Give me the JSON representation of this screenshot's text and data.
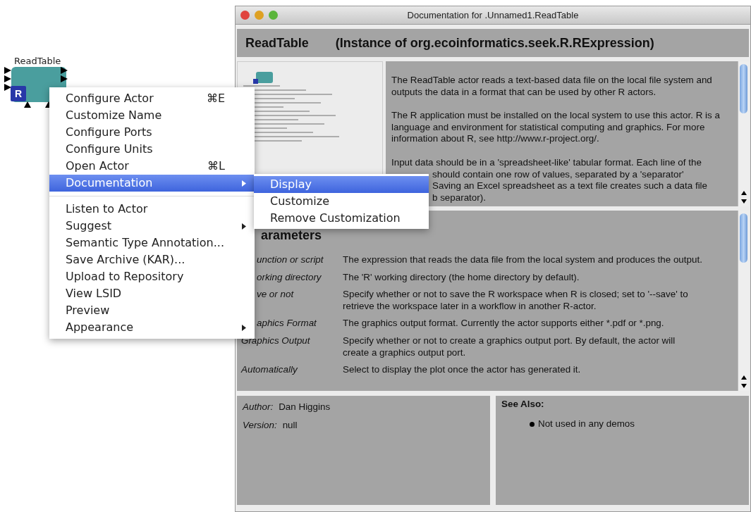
{
  "canvas": {
    "actor": {
      "label": "ReadTable",
      "badge": "R"
    }
  },
  "context_menu": {
    "items": [
      {
        "kind": "item",
        "label": "Configure Actor",
        "shortcut": "⌘E",
        "selected": false,
        "submenu": false
      },
      {
        "kind": "item",
        "label": "Customize Name",
        "selected": false,
        "submenu": false
      },
      {
        "kind": "item",
        "label": "Configure Ports",
        "selected": false,
        "submenu": false
      },
      {
        "kind": "item",
        "label": "Configure Units",
        "selected": false,
        "submenu": false
      },
      {
        "kind": "item",
        "label": "Open Actor",
        "shortcut": "⌘L",
        "selected": false,
        "submenu": false
      },
      {
        "kind": "item",
        "label": "Documentation",
        "selected": true,
        "submenu": true
      },
      {
        "kind": "separator"
      },
      {
        "kind": "item",
        "label": "Listen to Actor",
        "selected": false,
        "submenu": false
      },
      {
        "kind": "item",
        "label": "Suggest",
        "selected": false,
        "submenu": true
      },
      {
        "kind": "item",
        "label": "Semantic Type Annotation...",
        "selected": false,
        "submenu": false
      },
      {
        "kind": "item",
        "label": "Save Archive (KAR)...",
        "selected": false,
        "submenu": false
      },
      {
        "kind": "item",
        "label": "Upload to Repository",
        "selected": false,
        "submenu": false
      },
      {
        "kind": "item",
        "label": "View LSID",
        "selected": false,
        "submenu": false
      },
      {
        "kind": "item",
        "label": "Preview",
        "selected": false,
        "submenu": false
      },
      {
        "kind": "item",
        "label": "Appearance",
        "selected": false,
        "submenu": true
      }
    ]
  },
  "submenu": {
    "items": [
      {
        "label": "Display",
        "selected": true
      },
      {
        "label": "Customize",
        "selected": false
      },
      {
        "label": "Remove Customization",
        "selected": false
      }
    ]
  },
  "doc_window": {
    "title": "Documentation for .Unnamed1.ReadTable",
    "actor_name": "ReadTable",
    "instance": "(Instance of org.ecoinformatics.seek.R.RExpression)",
    "description": [
      "The ReadTable actor reads a text-based data file on the local file system and outputs the data in a format that can be used by other R actors.",
      "The R application must be installed on the local system to use this actor. R is a language and environment for statistical computing and graphics. For more information about R, see http://www.r-project.org/."
    ],
    "description_line": "Input data should be in a 'spreadsheet-like' tabular format. Each line of the",
    "description_partial_lines": [
      "should contain one row of values, separated by a 'separator'",
      "Saving an Excel spreadsheet as a text file creates such a data file",
      "b separator)."
    ],
    "parameters": {
      "heading": "arameters",
      "rows": [
        {
          "name": "unction or script",
          "kind": "partial",
          "text": "The expression that reads the data file from the local system and produces the output."
        },
        {
          "name": "orking directory",
          "kind": "partial",
          "text": "The 'R' working directory (the home directory by default)."
        },
        {
          "name": "ve or not",
          "kind": "partial",
          "text": "Specify whether or not to save the R workspace when R is closed; set to '--save' to retrieve the workspace later in a workflow in another R-actor."
        },
        {
          "name": "aphics Format",
          "kind": "partial",
          "text": "The graphics output format. Currently the actor supports either *.pdf or *.png."
        },
        {
          "name": "Graphics Output",
          "kind": "full",
          "text": "Specify whether or not to create a graphics output port. By default, the actor will create a graphics output port."
        },
        {
          "name": "Automatically",
          "kind": "full",
          "text": "Select to display the plot once the actor has generated it."
        }
      ]
    },
    "author_label": "Author:",
    "author": "Dan Higgins",
    "version_label": "Version:",
    "version": "null",
    "see_also": {
      "heading": "See Also:",
      "items": [
        "Not used in any demos"
      ]
    }
  }
}
